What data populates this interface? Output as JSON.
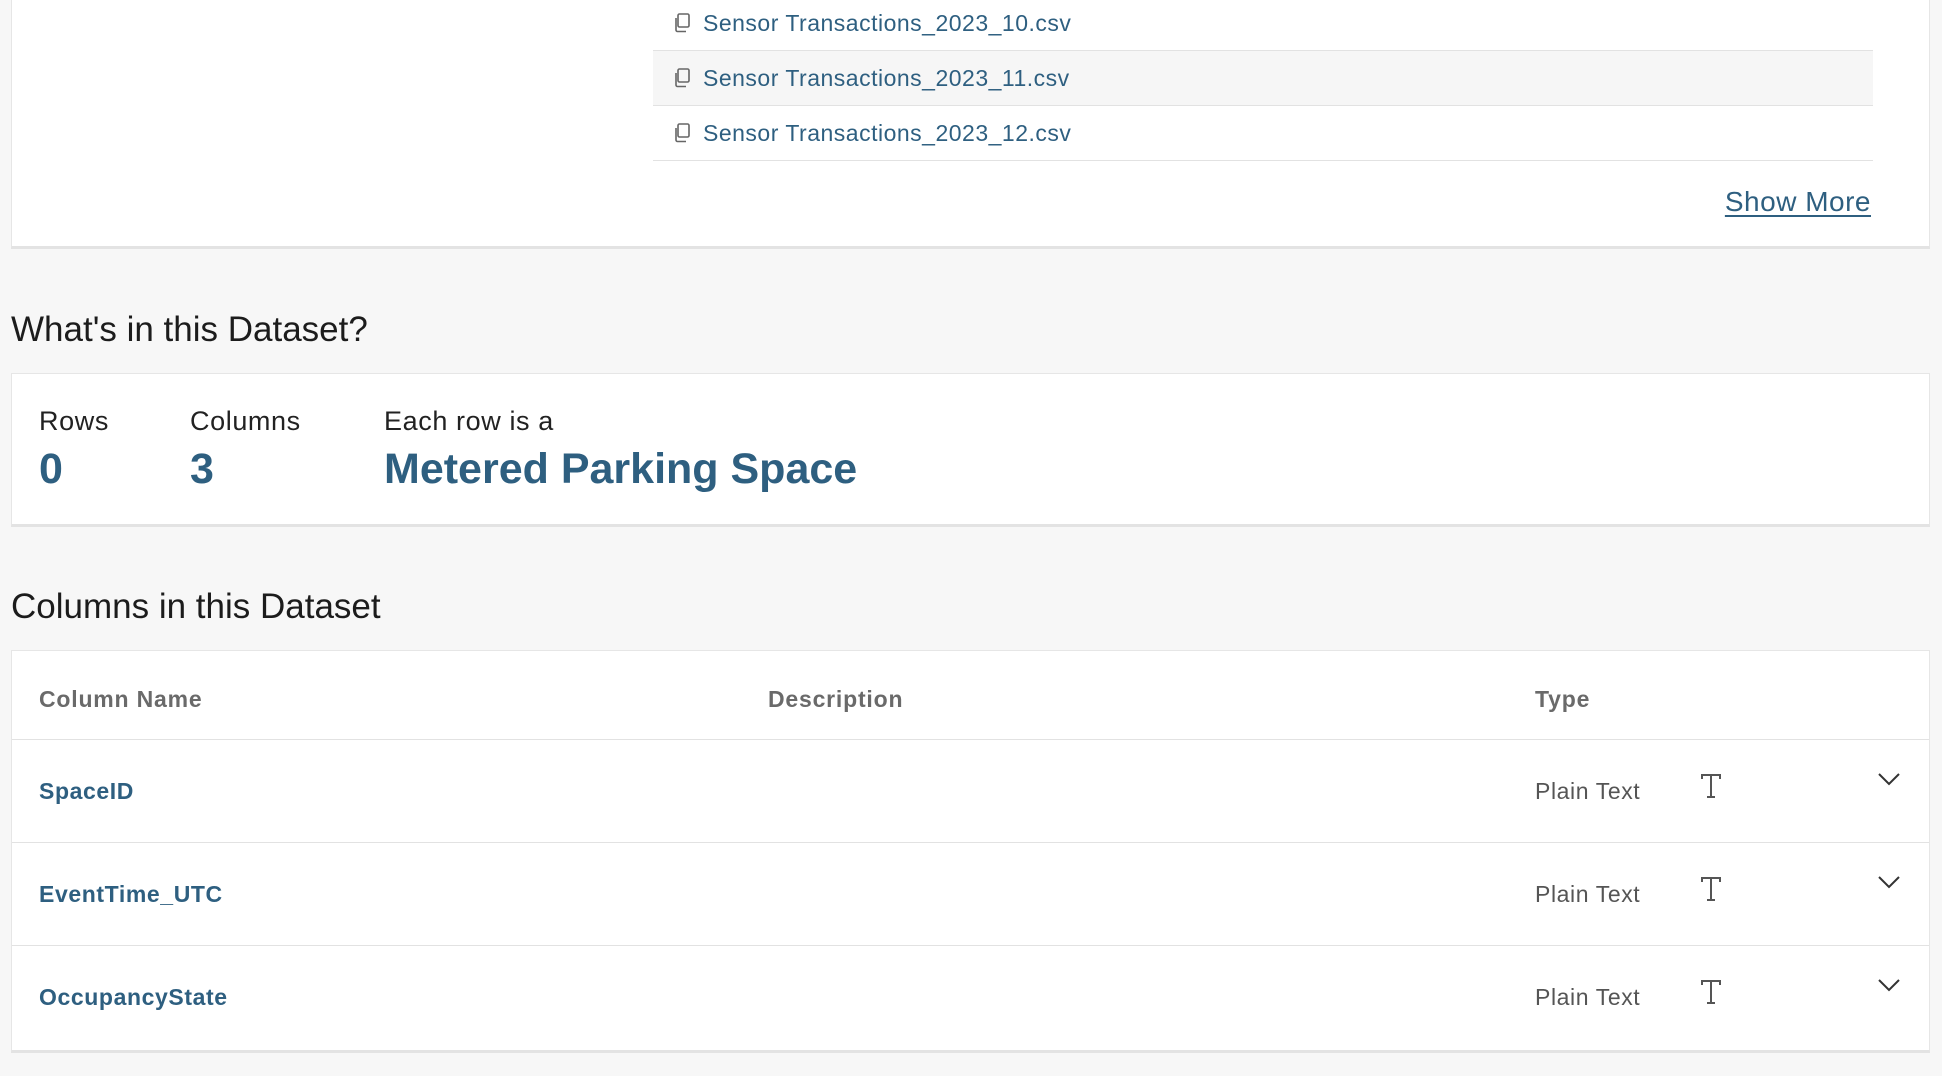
{
  "attachments": {
    "files": [
      {
        "name": "Sensor Transactions_2023_10.csv",
        "icon": "copy-icon"
      },
      {
        "name": "Sensor Transactions_2023_11.csv",
        "icon": "copy-icon"
      },
      {
        "name": "Sensor Transactions_2023_12.csv",
        "icon": "copy-icon"
      }
    ],
    "show_more_label": "Show More"
  },
  "summary": {
    "heading": "What's in this Dataset?",
    "rows_label": "Rows",
    "rows_value": "0",
    "columns_label": "Columns",
    "columns_value": "3",
    "row_entity_label": "Each row is a",
    "row_entity_value": "Metered Parking Space"
  },
  "columns_section": {
    "heading": "Columns in this Dataset",
    "headers": {
      "name": "Column Name",
      "description": "Description",
      "type": "Type"
    },
    "rows": [
      {
        "name": "SpaceID",
        "description": "",
        "type": "Plain Text",
        "type_icon": "text-type-icon"
      },
      {
        "name": "EventTime_UTC",
        "description": "",
        "type": "Plain Text",
        "type_icon": "text-type-icon"
      },
      {
        "name": "OccupancyState",
        "description": "",
        "type": "Plain Text",
        "type_icon": "text-type-icon"
      }
    ]
  },
  "colors": {
    "link": "#2e5f80",
    "background": "#f7f7f7",
    "card": "#ffffff"
  }
}
